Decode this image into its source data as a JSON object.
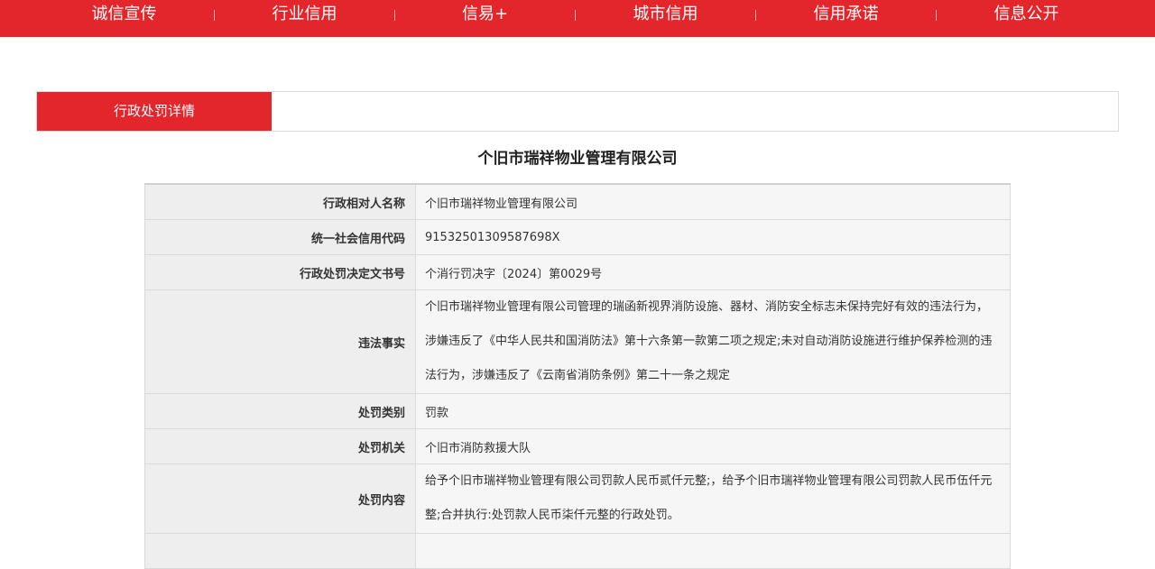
{
  "nav": {
    "items": [
      "诚信宣传",
      "行业信用",
      "信易+",
      "城市信用",
      "信用承诺",
      "信息公开"
    ]
  },
  "tabs": {
    "active_label": "行政处罚详情"
  },
  "company_title": "个旧市瑞祥物业管理有限公司",
  "details": [
    {
      "label": "行政相对人名称",
      "value": "个旧市瑞祥物业管理有限公司"
    },
    {
      "label": "统一社会信用代码",
      "value": "91532501309587698X"
    },
    {
      "label": "行政处罚决定文书号",
      "value": "个消行罚决字〔2024〕第0029号"
    },
    {
      "label": "违法事实",
      "value": "个旧市瑞祥物业管理有限公司管理的瑞函新视界消防设施、器材、消防安全标志未保持完好有效的违法行为，涉嫌违反了《中华人民共和国消防法》第十六条第一款第二项之规定;未对自动消防设施进行维护保养检测的违法行为，涉嫌违反了《云南省消防条例》第二十一条之规定"
    },
    {
      "label": "处罚类别",
      "value": "罚款"
    },
    {
      "label": "处罚机关",
      "value": "个旧市消防救援大队"
    },
    {
      "label": "处罚内容",
      "value": "给予个旧市瑞祥物业管理有限公司罚款人民币贰仟元整;，给予个旧市瑞祥物业管理有限公司罚款人民币伍仟元整;合并执行:处罚款人民币柒仟元整的行政处罚。"
    }
  ],
  "colors": {
    "brand_red": "#e3262b",
    "label_bg": "#eeeeee",
    "value_bg": "#f6f6f6"
  }
}
